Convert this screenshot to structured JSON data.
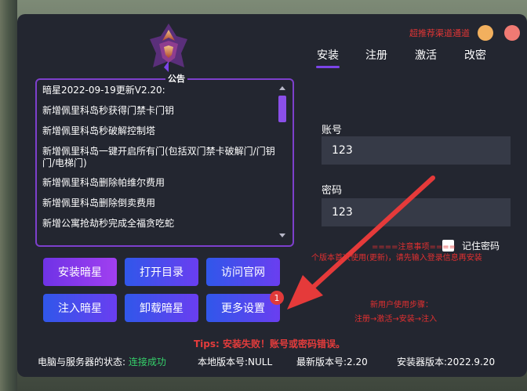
{
  "header": {
    "special_link": "超推荐渠道通道",
    "tabs": [
      "安装",
      "注册",
      "激活",
      "改密"
    ],
    "active_tab": 0
  },
  "notice": {
    "title": "公告",
    "items": [
      "暗星2022-09-19更新V2.20:",
      "新增佩里科岛秒获得门禁卡门钥",
      "新增佩里科岛秒破解控制塔",
      "新增佩里科岛一键开启所有门(包括双门禁卡破解门/门钥门/电梯门)",
      "新增佩里科岛删除帕维尔费用",
      "新增佩里科岛删除倒卖费用",
      "新增公寓抢劫秒完成全福贪吃蛇"
    ]
  },
  "form": {
    "account_label": "账号",
    "account_value": "123",
    "password_label": "密码",
    "password_value": "123",
    "remember_label": "记住密码"
  },
  "buttons": {
    "install": "安装暗星",
    "open_dir": "打开目录",
    "visit_site": "访问官网",
    "inject": "注入暗星",
    "uninstall": "卸载暗星",
    "more_settings": "更多设置",
    "more_badge": "1"
  },
  "notes": {
    "line1": "====注意事项====",
    "line2": "个版本首次使用(更新)，请先输入登录信息再安装",
    "line3": "新用户使用步骤：",
    "line4": "注册→激活→安装→注入"
  },
  "tips": "Tips:  安装失败！账号或密码错误。",
  "status": {
    "server_label": "电脑与服务器的状态:",
    "server_value": "连接成功",
    "local_version": "本地版本号:NULL",
    "latest_version": "最新版本号:2.20",
    "installer_version": "安装器版本:2022.9.20"
  },
  "colors": {
    "accent": "#7b44e8",
    "status_ok": "#35d06a",
    "warning_red": "#e53c3c"
  }
}
